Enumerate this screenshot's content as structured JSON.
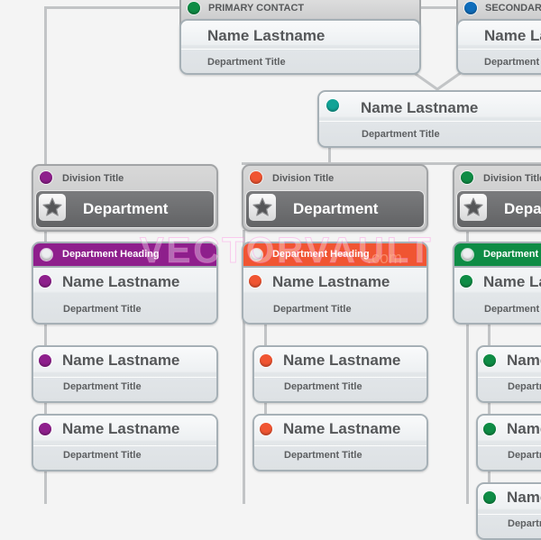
{
  "colors": {
    "green": "#0e8c45",
    "blue": "#0f6dbb",
    "teal": "#12a396",
    "purple": "#8e1f8c",
    "orange": "#f05532"
  },
  "top": {
    "primary": {
      "header": "PRIMARY CONTACT",
      "name": "Name Lastname",
      "title": "Department Title"
    },
    "secondary": {
      "header": "SECONDARY CONTACT",
      "name": "Name Lastname",
      "title": "Department Title"
    },
    "assistant": {
      "name": "Name Lastname",
      "title": "Department Title"
    }
  },
  "divisions": [
    {
      "division_title": "Division Title",
      "department": "Department",
      "icon": "star-icon",
      "department_heading": "Department Heading",
      "head": {
        "name": "Name Lastname",
        "title": "Department Title"
      },
      "members": [
        {
          "name": "Name Lastname",
          "title": "Department Title"
        },
        {
          "name": "Name Lastname",
          "title": "Department Title"
        }
      ]
    },
    {
      "division_title": "Division Title",
      "department": "Department",
      "icon": "star-icon",
      "department_heading": "Department Heading",
      "head": {
        "name": "Name Lastname",
        "title": "Department Title"
      },
      "members": [
        {
          "name": "Name Lastname",
          "title": "Department Title"
        },
        {
          "name": "Name Lastname",
          "title": "Department Title"
        }
      ]
    },
    {
      "division_title": "Division Title",
      "department": "Department",
      "icon": "star-icon",
      "department_heading": "Department Heading",
      "head": {
        "name": "Name Lastname",
        "title": "Department Title"
      },
      "members": [
        {
          "name": "Name Lastname",
          "title": "Department Title"
        },
        {
          "name": "Name Lastname",
          "title": "Department Title"
        },
        {
          "name": "Name Lastname",
          "title": "Department Title"
        }
      ]
    }
  ],
  "watermark": {
    "text": "VECTORVAULT",
    "suffix": ".com"
  }
}
